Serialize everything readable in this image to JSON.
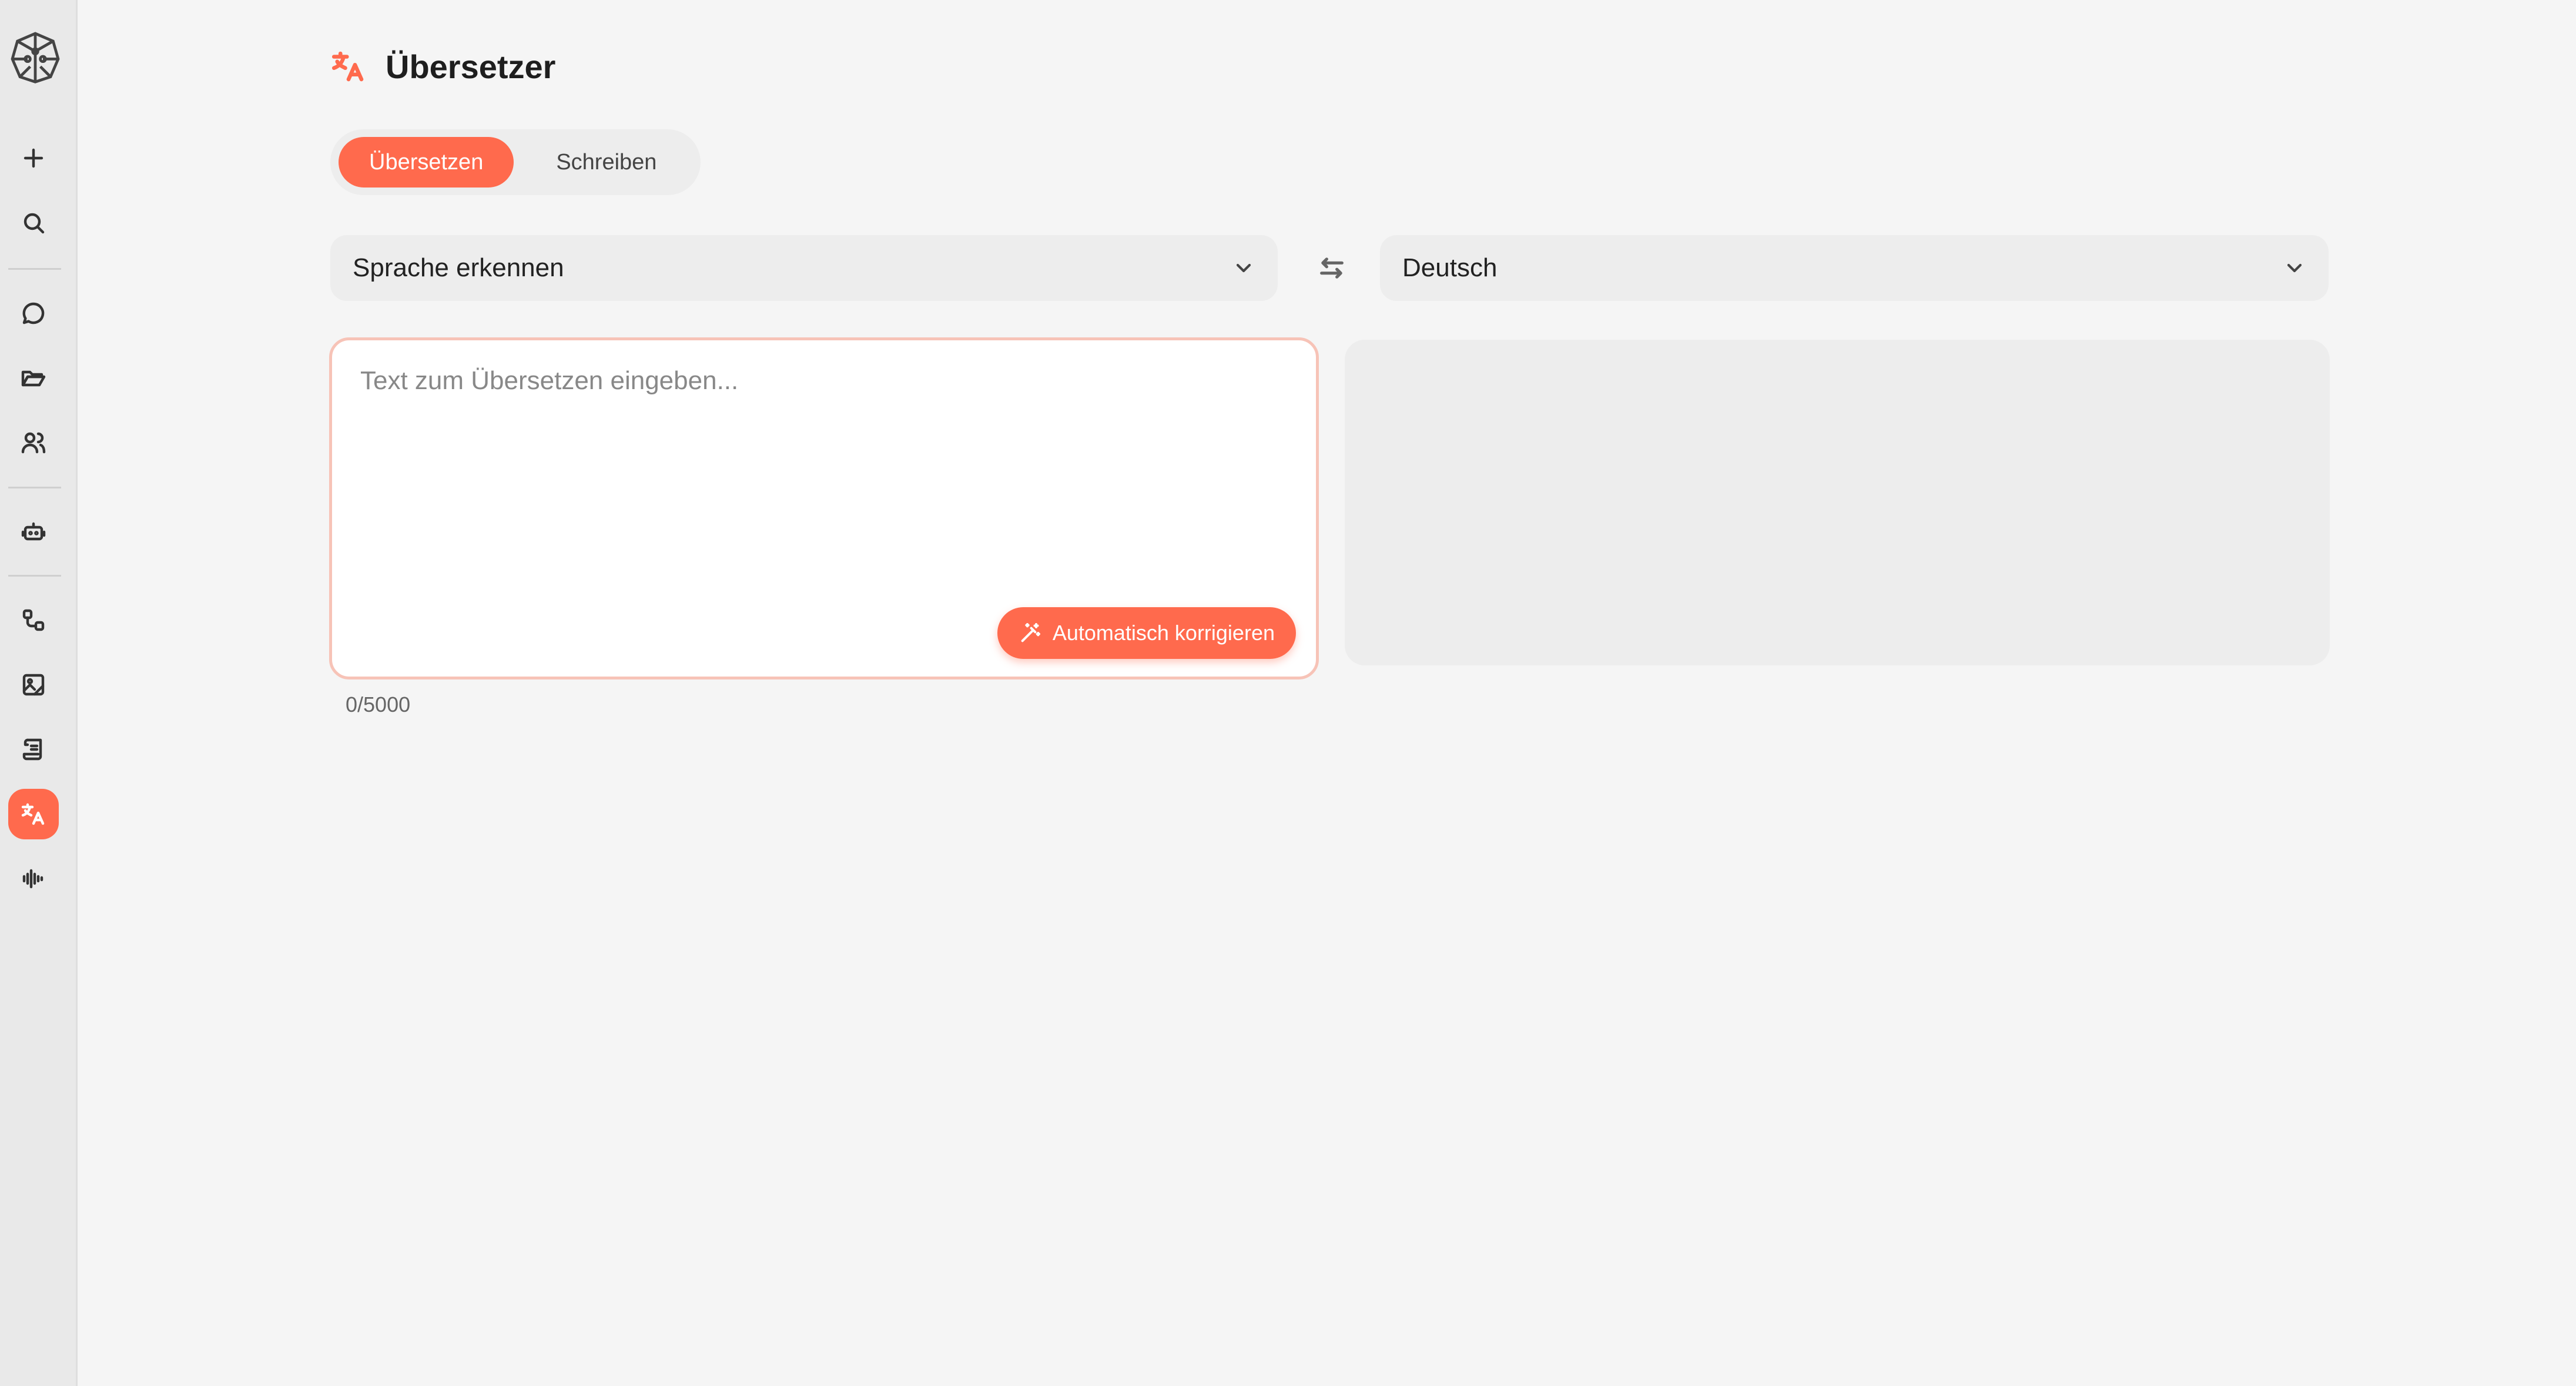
{
  "sidebar": {
    "items": [
      {
        "name": "new",
        "icon": "plus-icon"
      },
      {
        "name": "search",
        "icon": "search-icon"
      },
      {
        "name": "chat",
        "icon": "chat-bubble-icon"
      },
      {
        "name": "folders",
        "icon": "folder-open-icon"
      },
      {
        "name": "users",
        "icon": "users-icon"
      },
      {
        "name": "assistant",
        "icon": "robot-icon"
      },
      {
        "name": "workflows",
        "icon": "workflow-icon"
      },
      {
        "name": "image-gen",
        "icon": "image-edit-icon"
      },
      {
        "name": "documents",
        "icon": "document-scroll-icon"
      },
      {
        "name": "translator",
        "icon": "translate-icon",
        "active": true
      },
      {
        "name": "audio",
        "icon": "audio-wave-icon"
      }
    ]
  },
  "header": {
    "title": "Übersetzer",
    "icon": "translate-icon"
  },
  "tabs": [
    {
      "label": "Übersetzen",
      "active": true
    },
    {
      "label": "Schreiben",
      "active": false
    }
  ],
  "source_language": {
    "value": "Sprache erkennen"
  },
  "target_language": {
    "value": "Deutsch"
  },
  "input": {
    "placeholder": "Text zum Übersetzen eingeben...",
    "value": "",
    "counter": "0/5000",
    "autocorrect_label": "Automatisch korrigieren"
  },
  "output": {
    "value": ""
  },
  "colors": {
    "accent": "#ff6a4d",
    "background": "#f5f5f5",
    "sidebar": "#e9e9e9",
    "field": "#ededed"
  }
}
